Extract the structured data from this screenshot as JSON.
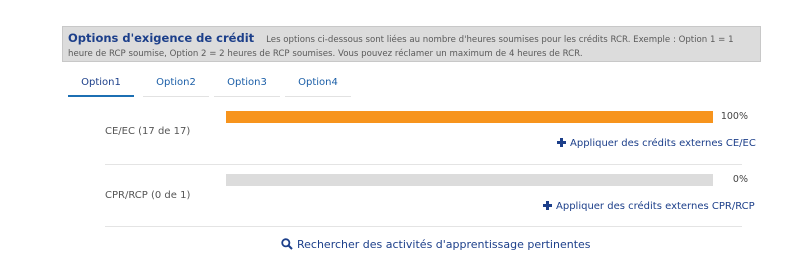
{
  "header": {
    "title": "Options d'exigence de crédit",
    "description": "Les options ci-dessous sont liées au nombre d'heures soumises pour les crédits RCR. Exemple : Option 1 = 1 heure de RCP soumise, Option 2 = 2 heures de RCP soumises. Vous pouvez réclamer un maximum de 4 heures de RCR."
  },
  "tabs": [
    {
      "label": "Option1",
      "active": true
    },
    {
      "label": "Option2",
      "active": false
    },
    {
      "label": "Option3",
      "active": false
    },
    {
      "label": "Option4",
      "active": false
    }
  ],
  "requirements": [
    {
      "label": "CE/EC (17 de 17)",
      "percent_text": "100%",
      "progress": 1.0,
      "link_label": "Appliquer des crédits externes CE/EC"
    },
    {
      "label": "CPR/RCP (0 de 1)",
      "percent_text": "0%",
      "progress": 0.0,
      "link_label": "Appliquer des crédits externes CPR/RCP"
    }
  ],
  "search_link": "Rechercher des activités d'apprentissage pertinentes",
  "colors": {
    "accent": "#1c3f8a",
    "progress_fill": "#f7941d",
    "progress_track": "#dcdcdc",
    "header_bg": "#dcdcdc"
  },
  "icons": {
    "add": "plus-icon",
    "search": "search-icon"
  }
}
